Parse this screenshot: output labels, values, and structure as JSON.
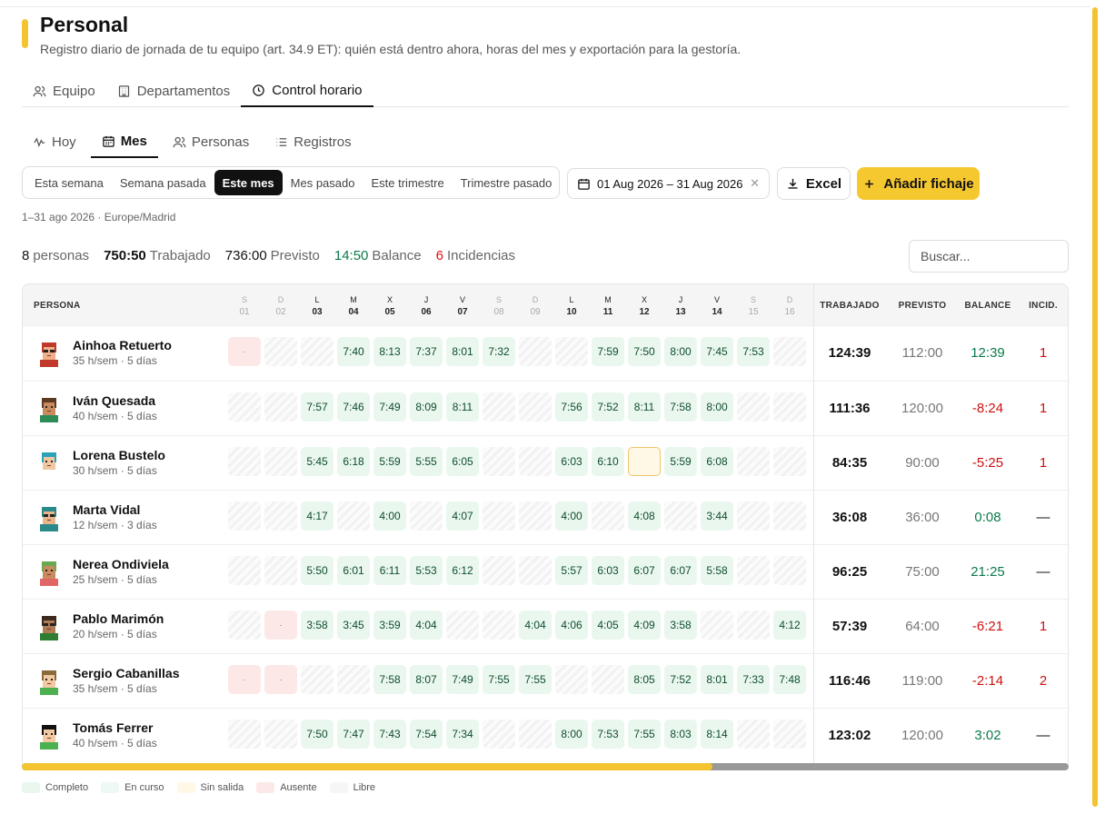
{
  "header": {
    "title": "Personal",
    "subtitle": "Registro diario de jornada de tu equipo (art. 34.9 ET): quién está dentro ahora, horas del mes y exportación para la gestoría."
  },
  "tabs": [
    {
      "label": "Equipo",
      "icon": "users-icon"
    },
    {
      "label": "Departamentos",
      "icon": "building-icon"
    },
    {
      "label": "Control horario",
      "icon": "clock-icon",
      "active": true
    }
  ],
  "subtabs": [
    {
      "label": "Hoy",
      "icon": "activity-icon"
    },
    {
      "label": "Mes",
      "icon": "calendar-icon",
      "active": true
    },
    {
      "label": "Personas",
      "icon": "users-icon"
    },
    {
      "label": "Registros",
      "icon": "list-icon"
    }
  ],
  "ranges": [
    "Esta semana",
    "Semana pasada",
    "Este mes",
    "Mes pasado",
    "Este trimestre",
    "Trimestre pasado"
  ],
  "active_range": "Este mes",
  "date_range": "01 Aug 2026 – 31 Aug 2026",
  "excel_label": "Excel",
  "add_label": "Añadir fichaje",
  "period": "1–31 ago 2026 · Europe/Madrid",
  "stats": {
    "personas": "8",
    "personas_label": "personas",
    "trabajado": "750:50",
    "trabajado_label": "Trabajado",
    "previsto": "736:00",
    "previsto_label": "Previsto",
    "balance": "14:50",
    "balance_label": "Balance",
    "incidencias": "6",
    "incidencias_label": "Incidencias"
  },
  "search_placeholder": "Buscar...",
  "columns": {
    "persona": "PERSONA",
    "trabajado": "TRABAJADO",
    "previsto": "PREVISTO",
    "balance": "BALANCE",
    "incid": "INCID."
  },
  "days": [
    {
      "l": "S",
      "n": "01"
    },
    {
      "l": "D",
      "n": "02"
    },
    {
      "l": "L",
      "n": "03"
    },
    {
      "l": "M",
      "n": "04"
    },
    {
      "l": "X",
      "n": "05"
    },
    {
      "l": "J",
      "n": "06"
    },
    {
      "l": "V",
      "n": "07"
    },
    {
      "l": "S",
      "n": "08"
    },
    {
      "l": "D",
      "n": "09"
    },
    {
      "l": "L",
      "n": "10"
    },
    {
      "l": "M",
      "n": "11"
    },
    {
      "l": "X",
      "n": "12"
    },
    {
      "l": "J",
      "n": "13"
    },
    {
      "l": "V",
      "n": "14"
    },
    {
      "l": "S",
      "n": "15"
    },
    {
      "l": "D",
      "n": "16"
    }
  ],
  "rows": [
    {
      "name": "Ainhoa Retuerto",
      "sub": "35 h/sem · 5 días",
      "cells": [
        "a:·",
        "f",
        "f",
        "d:7:40",
        "d:8:13",
        "d:7:37",
        "d:8:01",
        "d:7:32",
        "f",
        "f",
        "d:7:59",
        "d:7:50",
        "d:8:00",
        "d:7:45",
        "d:7:53",
        "f"
      ],
      "worked": "124:39",
      "planned": "112:00",
      "balance": "12:39",
      "incid": "1",
      "avatar": {
        "skin": "#f0b08a",
        "hair": "#c0392b",
        "shirt": "#c0392b",
        "glasses": true
      }
    },
    {
      "name": "Iván Quesada",
      "sub": "40 h/sem · 5 días",
      "cells": [
        "f",
        "f",
        "d:7:57",
        "d:7:46",
        "d:7:49",
        "d:8:09",
        "d:8:11",
        "f",
        "f",
        "d:7:56",
        "d:7:52",
        "d:8:11",
        "d:7:58",
        "d:8:00",
        "f",
        "f"
      ],
      "worked": "111:36",
      "planned": "120:00",
      "balance": "-8:24",
      "incid": "1",
      "avatar": {
        "skin": "#c98b5e",
        "hair": "#5a3a22",
        "shirt": "#2e8b57",
        "glasses": false
      }
    },
    {
      "name": "Lorena Bustelo",
      "sub": "30 h/sem · 5 días",
      "cells": [
        "f",
        "f",
        "d:5:45",
        "d:6:18",
        "d:5:59",
        "d:5:55",
        "d:6:05",
        "f",
        "f",
        "d:6:03",
        "d:6:10",
        "o:",
        "d:5:59",
        "d:6:08",
        "f",
        "f"
      ],
      "worked": "84:35",
      "planned": "90:00",
      "balance": "-5:25",
      "incid": "1",
      "avatar": {
        "skin": "#f1c7a2",
        "hair": "#2aa3b8",
        "shirt": "#ffffff",
        "glasses": false
      }
    },
    {
      "name": "Marta Vidal",
      "sub": "12 h/sem · 3 días",
      "cells": [
        "f",
        "f",
        "d:4:17",
        "f",
        "d:4:00",
        "f",
        "d:4:07",
        "f",
        "f",
        "d:4:00",
        "f",
        "d:4:08",
        "f",
        "d:3:44",
        "f",
        "f"
      ],
      "worked": "36:08",
      "planned": "36:00",
      "balance": "0:08",
      "incid": "—",
      "avatar": {
        "skin": "#e8b48a",
        "hair": "#2a8a8a",
        "shirt": "#2a8a8a",
        "glasses": true
      }
    },
    {
      "name": "Nerea Ondiviela",
      "sub": "25 h/sem · 5 días",
      "cells": [
        "f",
        "f",
        "d:5:50",
        "d:6:01",
        "d:6:11",
        "d:5:53",
        "d:6:12",
        "f",
        "f",
        "d:5:57",
        "d:6:03",
        "d:6:07",
        "d:6:07",
        "d:5:58",
        "f",
        "f"
      ],
      "worked": "96:25",
      "planned": "75:00",
      "balance": "21:25",
      "incid": "—",
      "avatar": {
        "skin": "#c98b5e",
        "hair": "#6aa84f",
        "shirt": "#e06666",
        "glasses": false
      }
    },
    {
      "name": "Pablo Marimón",
      "sub": "20 h/sem · 5 días",
      "cells": [
        "f",
        "a:·",
        "d:3:58",
        "d:3:45",
        "d:3:59",
        "d:4:04",
        "f",
        "f",
        "d:4:04",
        "d:4:06",
        "d:4:05",
        "d:4:09",
        "d:3:58",
        "f",
        "f",
        "d:4:12"
      ],
      "worked": "57:39",
      "planned": "64:00",
      "balance": "-6:21",
      "incid": "1",
      "avatar": {
        "skin": "#b07a52",
        "hair": "#3d2a1e",
        "shirt": "#2e7d32",
        "glasses": true
      }
    },
    {
      "name": "Sergio Cabanillas",
      "sub": "35 h/sem · 5 días",
      "cells": [
        "a:·",
        "a:·",
        "f",
        "f",
        "d:7:58",
        "d:8:07",
        "d:7:49",
        "d:7:55",
        "d:7:55",
        "f",
        "f",
        "d:8:05",
        "d:7:52",
        "d:8:01",
        "d:7:33",
        "d:7:48"
      ],
      "worked": "116:46",
      "planned": "119:00",
      "balance": "-2:14",
      "incid": "2",
      "avatar": {
        "skin": "#f2c9a0",
        "hair": "#8a6a3a",
        "shirt": "#4caf50",
        "glasses": false
      }
    },
    {
      "name": "Tomás Ferrer",
      "sub": "40 h/sem · 5 días",
      "cells": [
        "f",
        "f",
        "d:7:50",
        "d:7:47",
        "d:7:43",
        "d:7:54",
        "d:7:34",
        "f",
        "f",
        "d:8:00",
        "d:7:53",
        "d:7:55",
        "d:8:03",
        "d:8:14",
        "f",
        "f"
      ],
      "worked": "123:02",
      "planned": "120:00",
      "balance": "3:02",
      "incid": "—",
      "avatar": {
        "skin": "#f2c9a0",
        "hair": "#111111",
        "shirt": "#4caf50",
        "glasses": false
      }
    }
  ],
  "legend": [
    {
      "label": "Completo",
      "color": "#eaf7ef"
    },
    {
      "label": "En curso",
      "color": "#eef9f6"
    },
    {
      "label": "Sin salida",
      "color": "#fff8e6"
    },
    {
      "label": "Ausente",
      "color": "#fde8e8"
    },
    {
      "label": "Libre",
      "color": "#f6f6f6"
    }
  ],
  "colors": {
    "accent": "#f4c430",
    "positive": "#0b7a4a",
    "negative": "#cc1111"
  }
}
